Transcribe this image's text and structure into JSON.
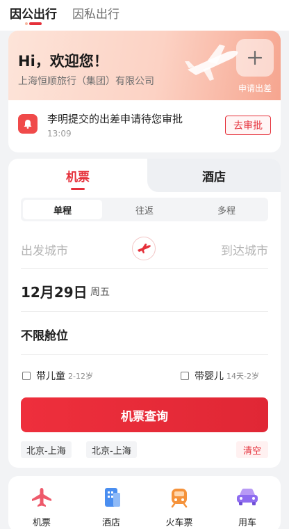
{
  "top_tabs": {
    "business": "因公出行",
    "private": "因私出行"
  },
  "banner": {
    "greeting": "Hi，欢迎您！",
    "company": "上海恒顺旅行（集团）有限公司",
    "add_trip_label": "申请出差"
  },
  "notice": {
    "text": "李明提交的出差申请待您审批",
    "time": "13:09",
    "action": "去审批"
  },
  "booking": {
    "tabs": {
      "flight": "机票",
      "hotel": "酒店"
    },
    "trip_types": [
      "单程",
      "往返",
      "多程"
    ],
    "from_city_placeholder": "出发城市",
    "to_city_placeholder": "到达城市",
    "date": "12月29日",
    "weekday": "周五",
    "cabin": "不限舱位",
    "with_child": {
      "label": "带儿童",
      "note": "2-12岁"
    },
    "with_infant": {
      "label": "带婴儿",
      "note": "14天-2岁"
    },
    "search_button": "机票查询",
    "history": [
      "北京-上海",
      "北京-上海"
    ],
    "clear": "清空"
  },
  "bottom_nav": [
    {
      "label": "机票",
      "icon": "plane-icon"
    },
    {
      "label": "酒店",
      "icon": "hotel-icon"
    },
    {
      "label": "火车票",
      "icon": "train-icon"
    },
    {
      "label": "用车",
      "icon": "car-icon"
    }
  ],
  "colors": {
    "accent": "#e5303a",
    "banner": "#fcd2c4"
  }
}
